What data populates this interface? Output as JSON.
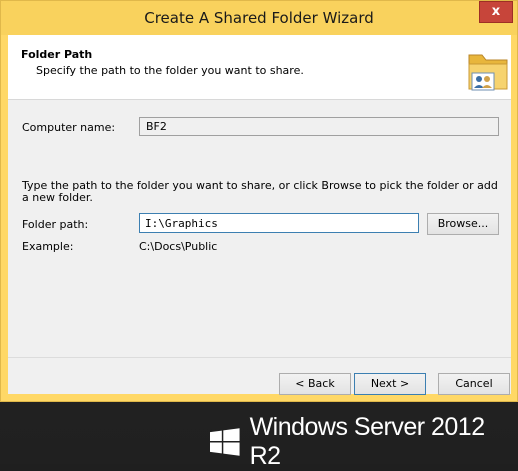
{
  "window": {
    "title": "Create A Shared Folder Wizard",
    "close_symbol": "x"
  },
  "header": {
    "title": "Folder Path",
    "subtitle": "Specify the path to the folder you want to share.",
    "icon": "shared-folder-icon"
  },
  "form": {
    "computer_name_label": "Computer name:",
    "computer_name_value": "BF2",
    "instructions": "Type the path to the folder you want to share, or click Browse to pick the folder or add a new folder.",
    "folder_path_label": "Folder path:",
    "folder_path_value": "I:\\Graphics",
    "browse_label": "Browse...",
    "example_label": "Example:",
    "example_value": "C:\\Docs\\Public"
  },
  "buttons": {
    "back": "< Back",
    "next": "Next >",
    "cancel": "Cancel"
  },
  "desktop": {
    "brand": "Windows Server 2012 R2",
    "logo_icon": "windows-logo-icon"
  },
  "colors": {
    "titlebar": "#f9d25d",
    "close_button": "#c7453a",
    "focus_border": "#3c7fb1",
    "client_bg": "#f0f0f0",
    "desktop_bg": "#202020"
  }
}
